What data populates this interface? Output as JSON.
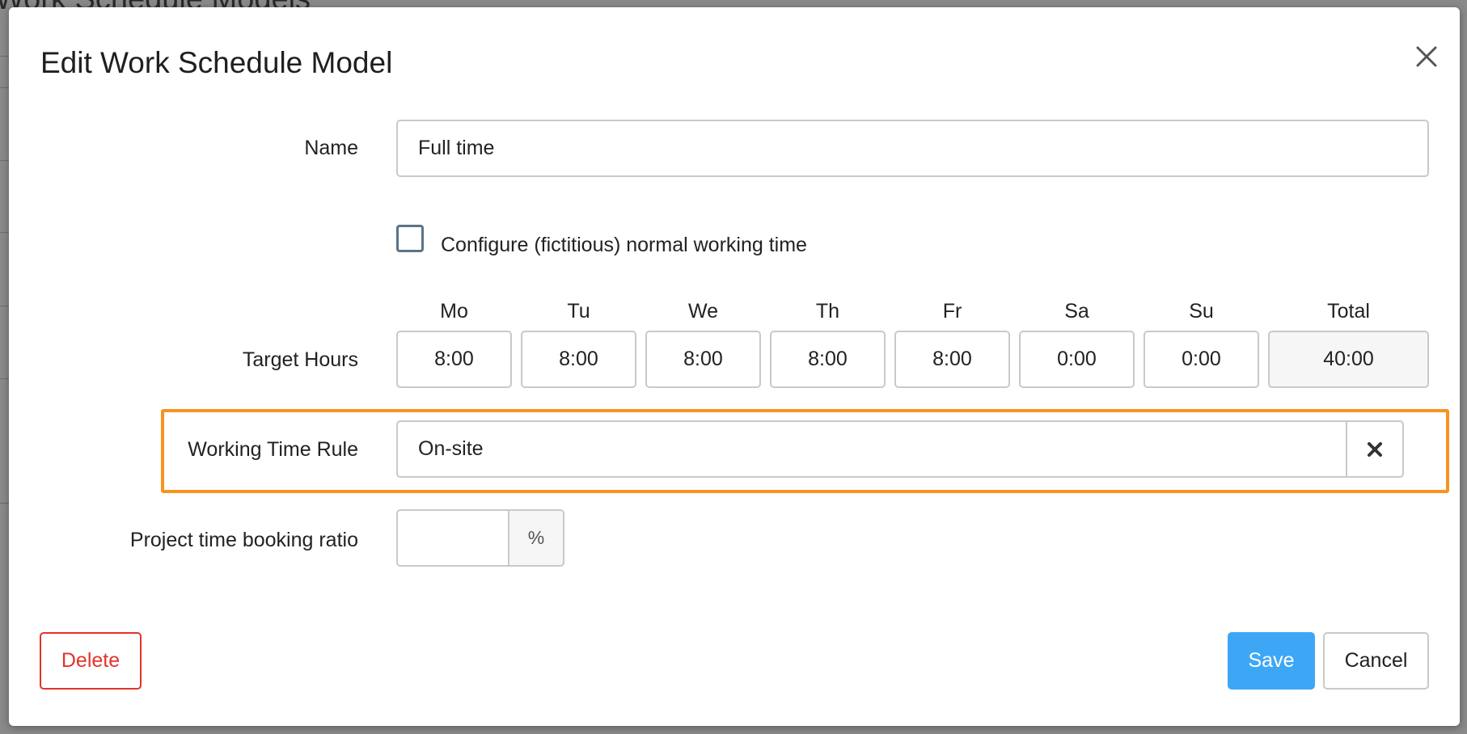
{
  "background": {
    "page_title": "Work Schedule Models"
  },
  "dialog": {
    "title": "Edit Work Schedule Model",
    "close_icon": "close-icon"
  },
  "form": {
    "name": {
      "label": "Name",
      "value": "Full time"
    },
    "normal_working_time": {
      "label": "Configure (fictitious) normal working time",
      "checked": false
    },
    "target_hours": {
      "label": "Target Hours",
      "days": [
        {
          "header": "Mo",
          "value": "8:00"
        },
        {
          "header": "Tu",
          "value": "8:00"
        },
        {
          "header": "We",
          "value": "8:00"
        },
        {
          "header": "Th",
          "value": "8:00"
        },
        {
          "header": "Fr",
          "value": "8:00"
        },
        {
          "header": "Sa",
          "value": "0:00"
        },
        {
          "header": "Su",
          "value": "0:00"
        }
      ],
      "total_header": "Total",
      "total_value": "40:00"
    },
    "working_time_rule": {
      "label": "Working Time Rule",
      "value": "On-site",
      "clear_icon": "clear-icon"
    },
    "project_booking_ratio": {
      "label": "Project time booking ratio",
      "value": "",
      "unit": "%"
    }
  },
  "buttons": {
    "delete": "Delete",
    "save": "Save",
    "cancel": "Cancel"
  },
  "colors": {
    "highlight": "#f7941d",
    "primary": "#3ea7f5",
    "danger": "#e2332b",
    "checkbox_border": "#5b7485"
  }
}
